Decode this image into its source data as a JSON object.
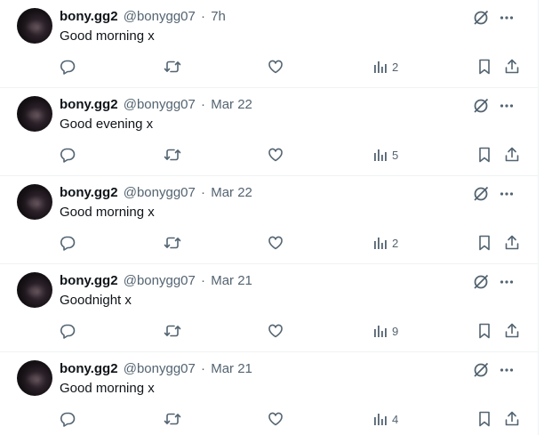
{
  "tweets": [
    {
      "name": "bony.gg2",
      "handle": "@bonygg07",
      "separator": "·",
      "time": "7h",
      "text": "Good morning x",
      "views": "2"
    },
    {
      "name": "bony.gg2",
      "handle": "@bonygg07",
      "separator": "·",
      "time": "Mar 22",
      "text": "Good evening x",
      "views": "5"
    },
    {
      "name": "bony.gg2",
      "handle": "@bonygg07",
      "separator": "·",
      "time": "Mar 22",
      "text": "Good morning x",
      "views": "2"
    },
    {
      "name": "bony.gg2",
      "handle": "@bonygg07",
      "separator": "·",
      "time": "Mar 21",
      "text": "Goodnight x",
      "views": "9"
    },
    {
      "name": "bony.gg2",
      "handle": "@bonygg07",
      "separator": "·",
      "time": "Mar 21",
      "text": "Good morning x",
      "views": "4"
    }
  ],
  "icons": {
    "grok": "grok-icon",
    "more": "more-icon",
    "reply": "reply-icon",
    "repost": "repost-icon",
    "like": "like-icon",
    "views": "views-icon",
    "bookmark": "bookmark-icon",
    "share": "share-icon"
  },
  "colors": {
    "text": "#0f1419",
    "secondary": "#536471",
    "border": "#eff3f4"
  }
}
